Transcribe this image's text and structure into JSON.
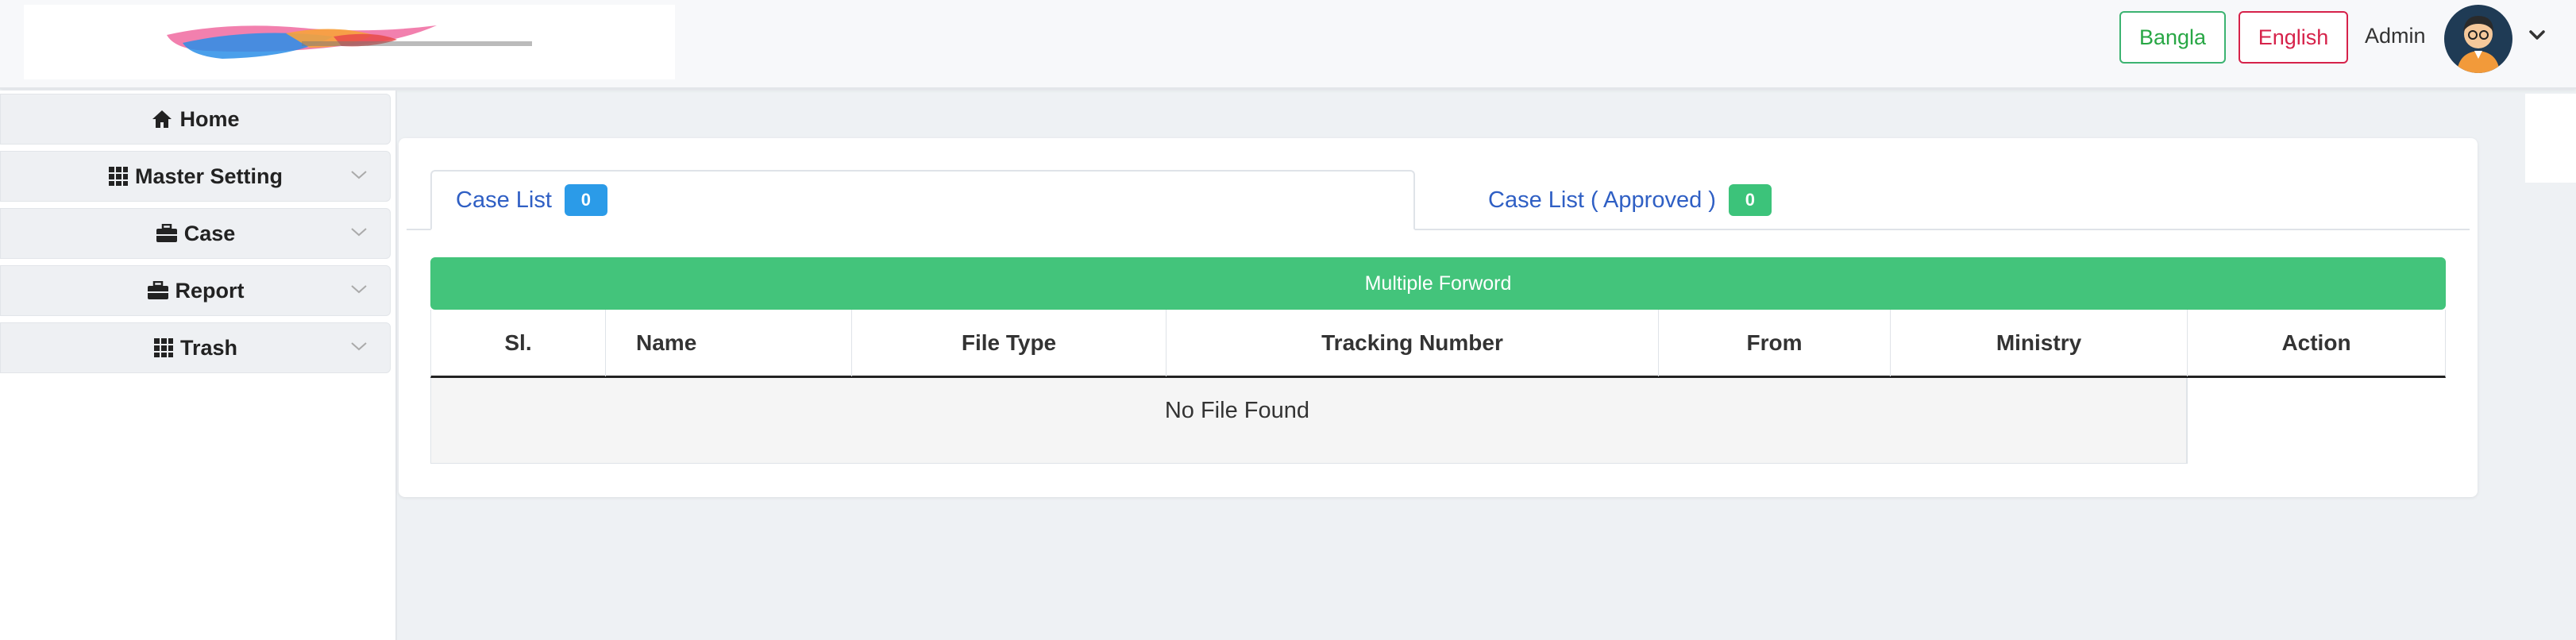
{
  "header": {
    "lang_bangla": "Bangla",
    "lang_english": "English",
    "user_name": "Admin",
    "colors": {
      "bangla": "#28a745",
      "english": "#d6224a"
    }
  },
  "sidebar": {
    "items": [
      {
        "label": "Home",
        "icon": "home-icon",
        "has_caret": false
      },
      {
        "label": "Master Setting",
        "icon": "grid-icon",
        "has_caret": true
      },
      {
        "label": "Case",
        "icon": "briefcase-icon",
        "has_caret": true
      },
      {
        "label": "Report",
        "icon": "briefcase-icon",
        "has_caret": true
      },
      {
        "label": "Trash",
        "icon": "grid-icon",
        "has_caret": true
      }
    ]
  },
  "tabs": [
    {
      "label": "Case List",
      "count": "0",
      "badge_color": "#2b9be8",
      "active": true
    },
    {
      "label": "Case List ( Approved )",
      "count": "0",
      "badge_color": "#3cc37a",
      "active": false
    }
  ],
  "actions": {
    "multiple_forward": "Multiple Forword",
    "color": "#43c47b"
  },
  "table": {
    "columns": [
      "Sl.",
      "Name",
      "File Type",
      "Tracking Number",
      "From",
      "Ministry",
      "Action"
    ],
    "empty_text": "No File Found"
  }
}
